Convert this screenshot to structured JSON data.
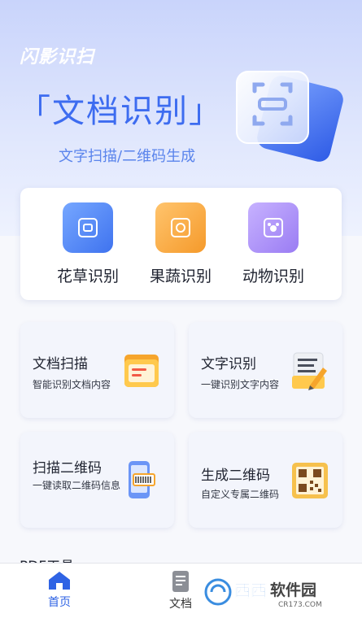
{
  "header": {
    "brand": "闪影识扫",
    "headline": "「文档识别」",
    "subtitle": "文字扫描/二维码生成"
  },
  "quick_tools": [
    {
      "label": "花草识别",
      "icon": "flower-scan-icon",
      "color": "#4f86f5"
    },
    {
      "label": "果蔬识别",
      "icon": "fruit-scan-icon",
      "color": "#f7a93b"
    },
    {
      "label": "动物识别",
      "icon": "animal-scan-icon",
      "color": "#a98ef6"
    }
  ],
  "features": [
    {
      "title": "文档扫描",
      "desc": "智能识别文档内容",
      "icon": "folder-doc-icon"
    },
    {
      "title": "文字识别",
      "desc": "一键识别文字内容",
      "icon": "text-edit-icon"
    },
    {
      "title": "扫描二维码",
      "desc": "一键读取二维码信息",
      "icon": "phone-scan-icon"
    },
    {
      "title": "生成二维码",
      "desc": "自定义专属二维码",
      "icon": "qrcode-icon"
    }
  ],
  "section_peek": "PDF工具",
  "tabbar": {
    "items": [
      {
        "label": "首页",
        "active": true
      },
      {
        "label": "文档",
        "active": false
      }
    ]
  },
  "watermark": {
    "text": "西西软件园",
    "sub": "CR173.COM"
  },
  "colors": {
    "accent": "#3d6cf0",
    "hero_bg": "#c9d4fb",
    "tab_active": "#2f63e4",
    "tab_inactive": "#333333"
  }
}
